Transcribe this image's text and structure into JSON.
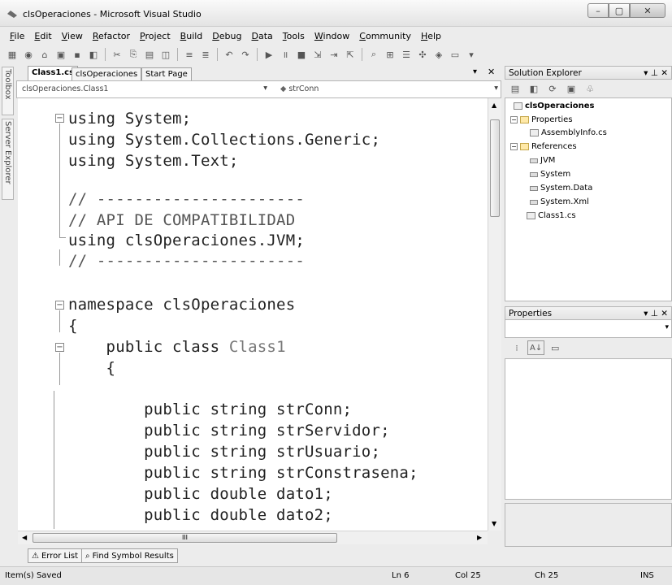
{
  "window": {
    "title": "clsOperaciones - Microsoft Visual Studio",
    "minimize": "–",
    "maximize": "▢",
    "close": "✕"
  },
  "menu": [
    "File",
    "Edit",
    "View",
    "Refactor",
    "Project",
    "Build",
    "Debug",
    "Data",
    "Tools",
    "Window",
    "Community",
    "Help"
  ],
  "side_tabs": {
    "toolbox": "Toolbox",
    "server_explorer": "Server Explorer"
  },
  "doc_tabs": {
    "tabs": [
      "Class1.cs",
      "clsOperaciones",
      "Start Page"
    ],
    "dropdown": "▾",
    "close": "✕"
  },
  "nav": {
    "type_combo": "clsOperaciones.Class1",
    "member_combo": "strConn"
  },
  "code": {
    "lines": [
      "using System;",
      "using System.Collections.Generic;",
      "using System.Text;",
      "",
      "// ----------------------",
      "// API DE COMPATIBILIDAD",
      "using clsOperaciones.JVM;",
      "// ----------------------",
      "",
      "namespace clsOperaciones",
      "{",
      "    public class ",
      "    {",
      "",
      "        public string strConn;",
      "        public string strServidor;",
      "        public string strUsuario;",
      "        public string strConstrasena;",
      "        public double dato1;",
      "        public double dato2;"
    ],
    "class_name": "Class1",
    "hscroll_grip": "III"
  },
  "solution_explorer": {
    "title": "Solution Explorer",
    "pin": "▾ ⊥ ✕",
    "tree": [
      {
        "label": "clsOperaciones",
        "bold": true
      },
      {
        "label": "Properties"
      },
      {
        "label": "AssemblyInfo.cs"
      },
      {
        "label": "References"
      },
      {
        "label": "JVM"
      },
      {
        "label": "System"
      },
      {
        "label": "System.Data"
      },
      {
        "label": "System.Xml"
      },
      {
        "label": "Class1.cs"
      }
    ]
  },
  "properties": {
    "title": "Properties",
    "pin": "▾ ⊥ ✕",
    "sort_label": "A↓"
  },
  "bottom_tabs": [
    "Error List",
    "Find Symbol Results"
  ],
  "status": {
    "message": "Item(s) Saved",
    "line": "Ln 6",
    "col": "Col 25",
    "ch": "Ch 25",
    "mode": "INS"
  }
}
